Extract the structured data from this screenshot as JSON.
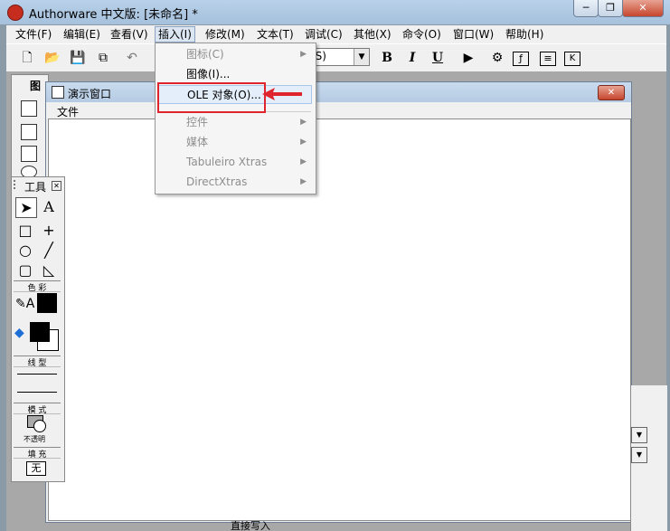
{
  "window": {
    "title": "Authorware 中文版: [未命名] *",
    "minimize_label": "─",
    "restore_label": "❐",
    "close_label": "✕"
  },
  "menubar": {
    "items": [
      {
        "label": "文件(F)"
      },
      {
        "label": "编辑(E)"
      },
      {
        "label": "查看(V)"
      },
      {
        "label": "插入(I)"
      },
      {
        "label": "修改(M)"
      },
      {
        "label": "文本(T)"
      },
      {
        "label": "调试(C)"
      },
      {
        "label": "其他(X)"
      },
      {
        "label": "命令(O)"
      },
      {
        "label": "窗口(W)"
      },
      {
        "label": "帮助(H)"
      }
    ]
  },
  "toolbar": {
    "font_combo_value": "(S)",
    "bold": "B",
    "italic": "I",
    "underline": "U"
  },
  "icon_palette": {
    "title": "图"
  },
  "insert_menu": {
    "items": [
      {
        "label": "图标(C)",
        "disabled": true,
        "submenu": true
      },
      {
        "label": "图像(I)...",
        "disabled": false,
        "submenu": false
      },
      {
        "label": "OLE 对象(O)...",
        "disabled": false,
        "submenu": false,
        "highlighted": true
      },
      {
        "label": "控件",
        "disabled": true,
        "submenu": true
      },
      {
        "label": "媒体",
        "disabled": true,
        "submenu": true
      },
      {
        "label": "Tabuleiro Xtras",
        "disabled": true,
        "submenu": true
      },
      {
        "label": "DirectXtras",
        "disabled": true,
        "submenu": true
      }
    ]
  },
  "presentation_window": {
    "title": "演示窗口",
    "menu_file": "文件",
    "close_label": "✕"
  },
  "tools_palette": {
    "title": "工具",
    "color_label": "色 彩",
    "line_label": "线 型",
    "mode_label": "模 式",
    "mode_value": "不透明",
    "fill_label": "填 充",
    "fill_value": "无"
  },
  "status_fragment": "直接写入"
}
